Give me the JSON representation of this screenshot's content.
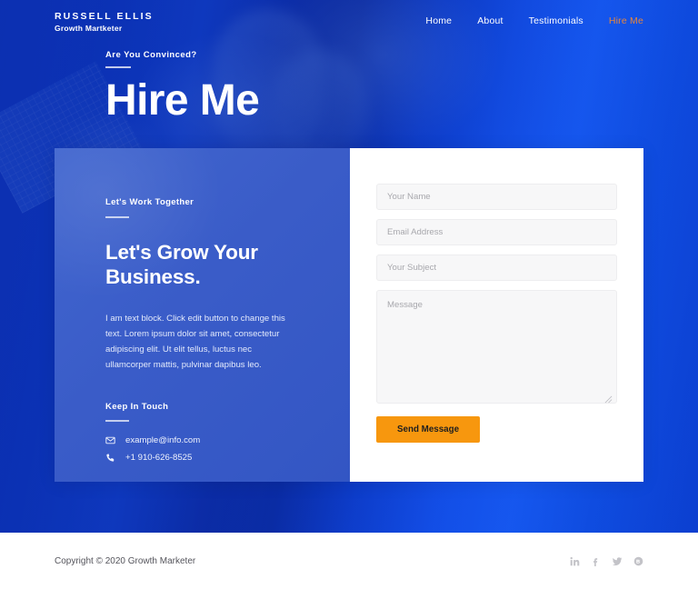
{
  "brand": {
    "name": "RUSSELL ELLIS",
    "tagline": "Growth Martketer"
  },
  "nav": {
    "items": [
      {
        "label": "Home",
        "active": false
      },
      {
        "label": "About",
        "active": false
      },
      {
        "label": "Testimonials",
        "active": false
      },
      {
        "label": "Hire Me",
        "active": true
      }
    ],
    "active_color": "#e8863a"
  },
  "hero": {
    "kicker": "Are You Convinced?",
    "title": "Hire Me"
  },
  "contact_panel": {
    "kicker": "Let's Work Together",
    "title": "Let's Grow Your Business.",
    "body": "I am text block. Click edit button to change this text. Lorem ipsum dolor sit amet, consectetur adipiscing elit. Ut elit tellus, luctus nec ullamcorper mattis, pulvinar dapibus leo.",
    "touch_heading": "Keep In Touch",
    "contacts": [
      {
        "icon": "envelope-icon",
        "value": "example@info.com"
      },
      {
        "icon": "phone-icon",
        "value": "+1 910-626-8525"
      }
    ]
  },
  "form": {
    "name_placeholder": "Your Name",
    "name_value": "",
    "email_placeholder": "Email Address",
    "email_value": "",
    "subject_placeholder": "Your Subject",
    "subject_value": "",
    "message_placeholder": "Message",
    "message_value": "",
    "submit_label": "Send Message",
    "submit_color": "#f7970e"
  },
  "footer": {
    "copyright": "Copyright © 2020 Growth Marketer",
    "socials": [
      {
        "name": "linkedin-icon"
      },
      {
        "name": "facebook-icon"
      },
      {
        "name": "twitter-icon"
      },
      {
        "name": "behance-icon"
      }
    ]
  }
}
